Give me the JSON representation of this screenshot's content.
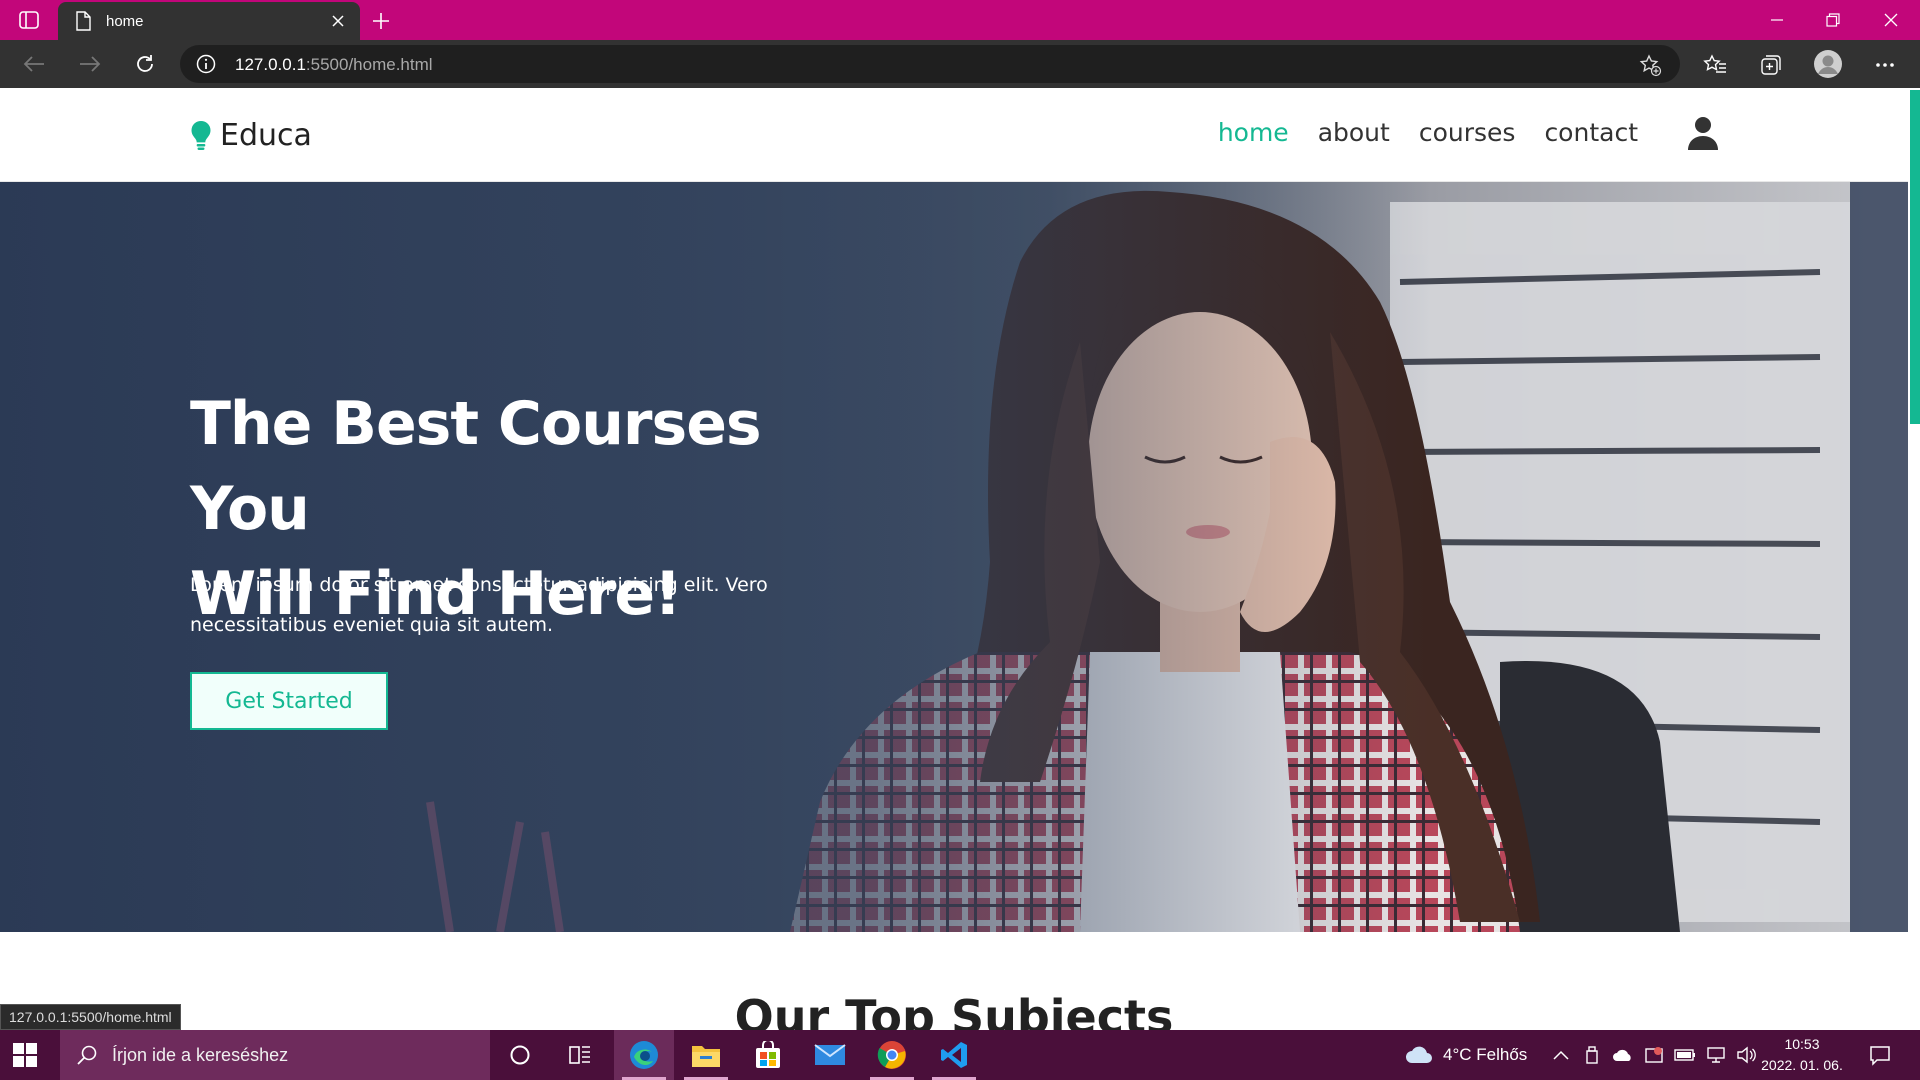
{
  "browser": {
    "tab_title": "home",
    "url_host": "127.0.0.1",
    "url_path": ":5500/home.html",
    "status_url": "127.0.0.1:5500/home.html",
    "accent_color": "#c2067a"
  },
  "site": {
    "logo_text": "Educa",
    "nav": [
      {
        "label": "home",
        "active": true
      },
      {
        "label": "about",
        "active": false
      },
      {
        "label": "courses",
        "active": false
      },
      {
        "label": "contact",
        "active": false
      }
    ],
    "accent_color": "#14b892",
    "hero": {
      "title_line1": "The Best Courses You",
      "title_line2": "Will Find Here!",
      "text": "Lorem ipsum dolor sit amet consectetur adipisicing elit. Vero necessitatibus eveniet quia sit autem.",
      "cta_label": "Get Started"
    },
    "section_heading": "Our Top Subjects"
  },
  "taskbar": {
    "search_placeholder": "Írjon ide a kereséshez",
    "weather": "4°C  Felhős",
    "time": "10:53",
    "date": "2022. 01. 06."
  }
}
